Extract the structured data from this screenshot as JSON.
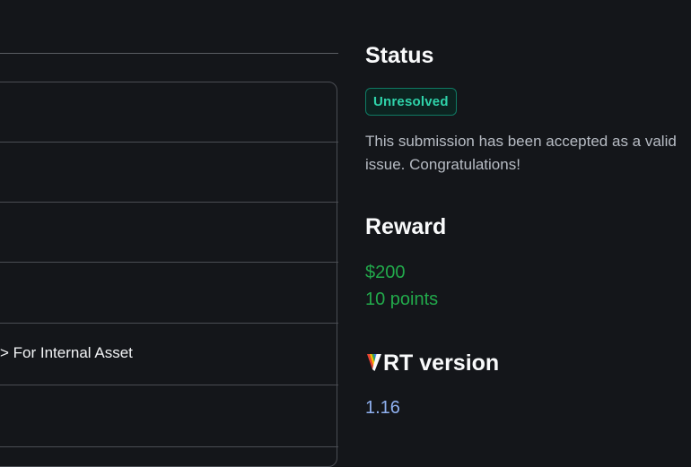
{
  "table": {
    "row_partial_text": "> For Internal Asset"
  },
  "status": {
    "heading": "Status",
    "badge": "Unresolved",
    "description": "This submission has been accepted as a valid issue. Congratulations!",
    "badge_color": "#2fd3aa"
  },
  "reward": {
    "heading": "Reward",
    "amount": "$200",
    "points": "10 points",
    "color": "#22a94b"
  },
  "vrt": {
    "heading_suffix": "RT version",
    "version": "1.16",
    "logo_icon": "vrt-rainbow-v-icon"
  },
  "colors": {
    "background": "#14161a",
    "border": "#4a4d53",
    "link": "#8fb0ef"
  }
}
